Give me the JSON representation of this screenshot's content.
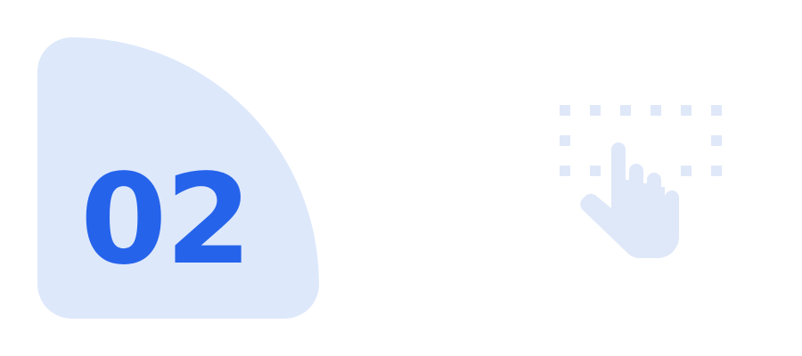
{
  "step": {
    "number": "02",
    "badge_color": "#dde8fb",
    "number_color": "#2563eb"
  },
  "icon": {
    "name": "tap-select-icon",
    "color": "#dfe8f8"
  }
}
